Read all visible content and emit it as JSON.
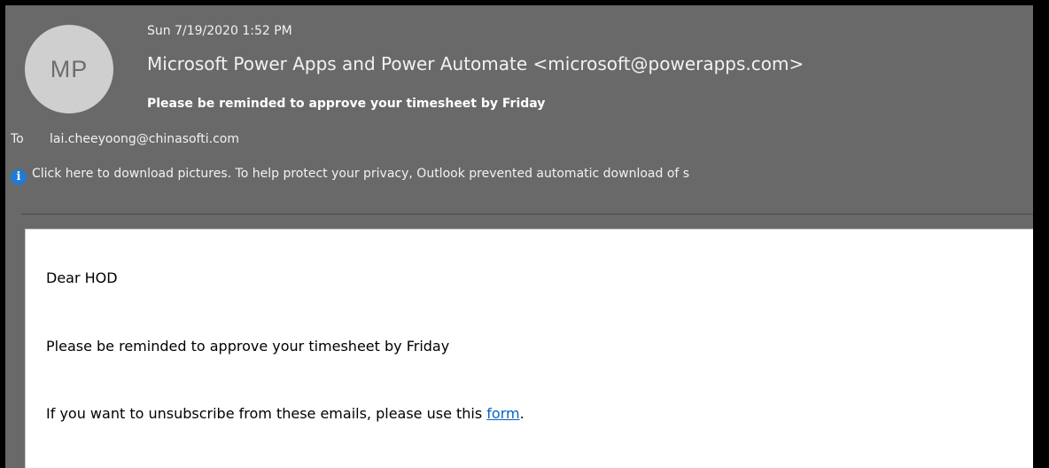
{
  "header": {
    "avatar_initials": "MP",
    "datetime": "Sun 7/19/2020 1:52 PM",
    "sender": "Microsoft Power Apps and Power Automate <microsoft@powerapps.com>",
    "subject": "Please be reminded to approve  your timesheet by Friday"
  },
  "recipients": {
    "to_label": "To",
    "to_address": "lai.cheeyoong@chinasofti.com"
  },
  "info_bar": {
    "icon": "info-icon",
    "text": "Click here to download pictures. To help protect your privacy, Outlook prevented automatic download of s"
  },
  "body": {
    "greeting": "Dear HOD",
    "message": "Please be reminded to approve  your timesheet by Friday",
    "unsubscribe_prefix": "If you want to unsubscribe from these emails, please use this ",
    "unsubscribe_link": "form",
    "unsubscribe_suffix": "."
  },
  "colors": {
    "header_background": "#696969",
    "avatar_background": "#cfcfcf",
    "info_icon": "#1f7bd6",
    "link": "#0563c1"
  }
}
